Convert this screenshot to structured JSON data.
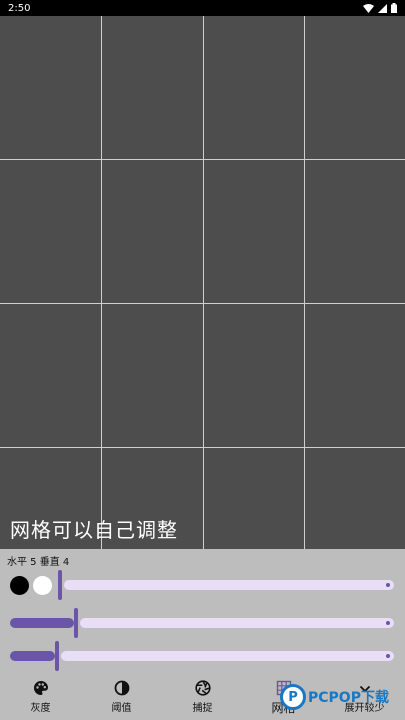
{
  "status_bar": {
    "time": "2:50"
  },
  "canvas": {
    "grid_columns": 4,
    "grid_rows": 4,
    "background_color": "#4d4d4d",
    "grid_line_color": "#cfcfcf"
  },
  "caption": "网格可以自己调整",
  "controls": {
    "grid_count_label": "水平 5 垂直 4",
    "swatches": [
      {
        "name": "black",
        "color": "#000000"
      },
      {
        "name": "white",
        "color": "#ffffff"
      }
    ],
    "sliders": [
      {
        "name": "slider-1",
        "fraction": 0.0
      },
      {
        "name": "slider-2",
        "fraction": 0.17
      },
      {
        "name": "slider-3",
        "fraction": 0.12
      }
    ],
    "accent_color": "#6a55a8",
    "track_color": "#e8dff7"
  },
  "bottom_nav": {
    "items": [
      {
        "label": "灰度",
        "icon": "palette-icon"
      },
      {
        "label": "阈值",
        "icon": "contrast-icon"
      },
      {
        "label": "捕捉",
        "icon": "aperture-icon"
      },
      {
        "label": "网格",
        "icon": "grid-icon"
      },
      {
        "label": "展开较少",
        "icon": "chevron-up-icon"
      }
    ],
    "active_index": 3
  },
  "watermark": {
    "text": "PCPOP下载",
    "logo_letter": "P"
  }
}
